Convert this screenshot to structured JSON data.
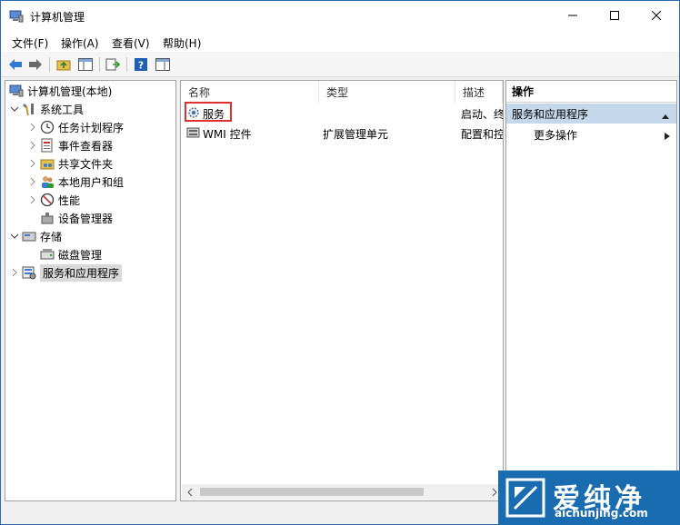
{
  "window": {
    "title": "计算机管理",
    "minimize_icon": "minimize-icon",
    "maximize_icon": "maximize-icon",
    "close_icon": "close-icon"
  },
  "menu": [
    {
      "label": "文件(F)"
    },
    {
      "label": "操作(A)"
    },
    {
      "label": "查看(V)"
    },
    {
      "label": "帮助(H)"
    }
  ],
  "toolbar": {
    "icons": [
      "back-icon",
      "forward-icon",
      "up-folder-icon",
      "show-hide-tree-icon",
      "export-list-icon",
      "help-icon",
      "show-hide-action-pane-icon"
    ]
  },
  "tree": {
    "root": "计算机管理(本地)",
    "system_tools": "系统工具",
    "task_scheduler": "任务计划程序",
    "event_viewer": "事件查看器",
    "shared_folders": "共享文件夹",
    "local_users": "本地用户和组",
    "performance": "性能",
    "device_manager": "设备管理器",
    "storage": "存储",
    "disk_management": "磁盘管理",
    "services_apps": "服务和应用程序"
  },
  "list": {
    "columns": [
      "名称",
      "类型",
      "描述"
    ],
    "rows": [
      {
        "name": "服务",
        "type": "",
        "desc": "启动、终"
      },
      {
        "name": "WMI 控件",
        "type": "扩展管理单元",
        "desc": "配置和控"
      }
    ]
  },
  "actions": {
    "header": "操作",
    "group": "服务和应用程序",
    "more": "更多操作"
  },
  "watermark": {
    "text": "爱纯净",
    "sub": "aichunjing.com"
  },
  "colors": {
    "accent": "#1a6cb0",
    "highlight": "#e03131",
    "action_group_bg": "#c5d7ea"
  }
}
